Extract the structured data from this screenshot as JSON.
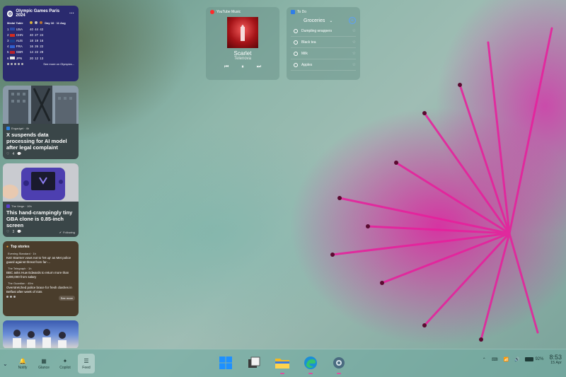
{
  "olympics": {
    "title": "Olympic Games Paris 2024",
    "more": "···",
    "table_header": {
      "label": "Medal Table",
      "dates": "Day 16 · 11 Aug"
    },
    "rows": [
      {
        "rank": "1",
        "country": "USA",
        "gold": "40",
        "silver": "44",
        "bronze": "42",
        "flag_color": "#2c4aa8"
      },
      {
        "rank": "2",
        "country": "CHN",
        "gold": "40",
        "silver": "27",
        "bronze": "24",
        "flag_color": "#d62b1e"
      },
      {
        "rank": "3",
        "country": "AUS",
        "gold": "18",
        "silver": "19",
        "bronze": "16",
        "flag_color": "#1b3f8a"
      },
      {
        "rank": "4",
        "country": "FRA",
        "gold": "16",
        "silver": "26",
        "bronze": "22",
        "flag_color": "#2f5fd0"
      },
      {
        "rank": "5",
        "country": "GBR",
        "gold": "14",
        "silver": "22",
        "bronze": "29",
        "flag_color": "#b8202a"
      },
      {
        "rank": "6",
        "country": "JPN",
        "gold": "20",
        "silver": "12",
        "bronze": "13",
        "flag_color": "#e8e8e8"
      }
    ],
    "see_more": "See more on Olympics..."
  },
  "news1": {
    "source": "Engadget · 4h",
    "headline": "X suspends data processing for AI model after legal complaint",
    "likes": "4"
  },
  "news2": {
    "source": "The Verge · 10h",
    "headline": "This hand-crampingly tiny GBA clone is 0.85-inch screen",
    "likes": "3",
    "following": "Following"
  },
  "top_stories": {
    "title": "Top stories",
    "items": [
      {
        "source": "Evening Standard · 1h",
        "text": "Keir Starmer vows not to 'let up' as Met police guard against threat from far-..."
      },
      {
        "source": "The Telegraph · 1h",
        "text": "BBC asks Huw Edwards to return more than £200,000 from salary"
      },
      {
        "source": "The Guardian · 40m",
        "text": "Overstretched police brace for fresh clashes in Belfast after week of riots"
      }
    ],
    "see_more": "See more"
  },
  "music": {
    "app": "YouTube Music",
    "title": "Scarlet",
    "artist": "Telenova"
  },
  "todo": {
    "app": "To Do",
    "list": "Groceries",
    "tasks": [
      "Dumpling wrappers",
      "Black tea",
      "Milk",
      "Apples"
    ]
  },
  "taskbar": {
    "notify": "Notify",
    "glance": "Glance",
    "copilot": "Copilot",
    "feed": "Feed",
    "battery": "92%",
    "battery_level": 0.92,
    "time": "8:53",
    "date": "15 Apr"
  },
  "colors": {
    "accent": "#e04fa0",
    "gold": "#d9b23a",
    "silver": "#c0c0c0",
    "bronze": "#b87333"
  }
}
